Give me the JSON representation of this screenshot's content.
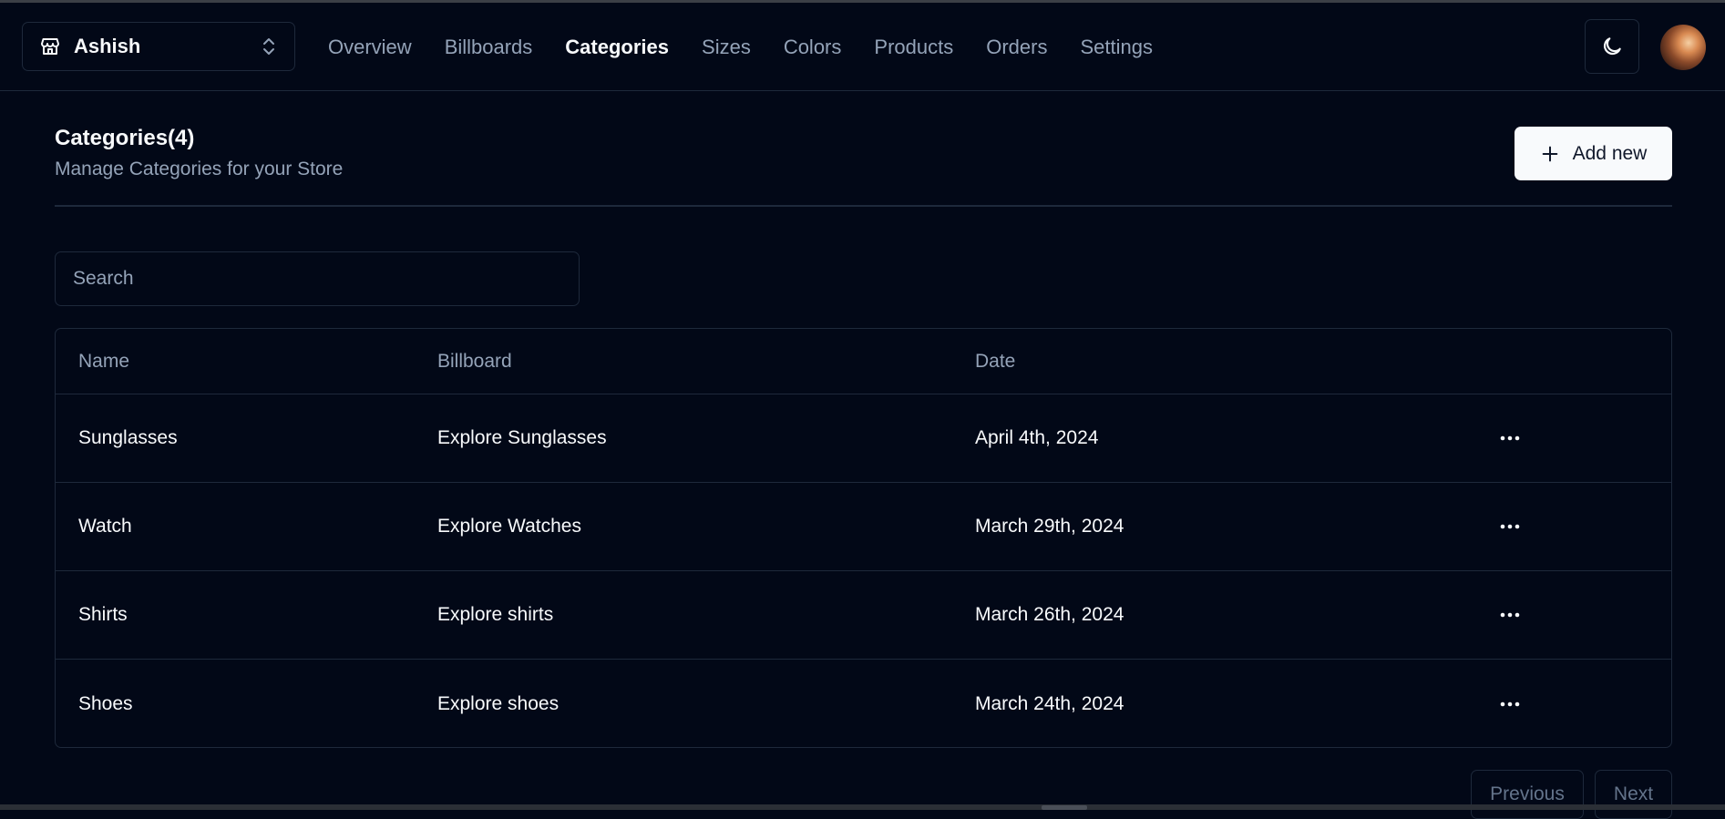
{
  "store": {
    "name": "Ashish"
  },
  "nav": {
    "items": [
      {
        "label": "Overview",
        "active": false
      },
      {
        "label": "Billboards",
        "active": false
      },
      {
        "label": "Categories",
        "active": true
      },
      {
        "label": "Sizes",
        "active": false
      },
      {
        "label": "Colors",
        "active": false
      },
      {
        "label": "Products",
        "active": false
      },
      {
        "label": "Orders",
        "active": false
      },
      {
        "label": "Settings",
        "active": false
      }
    ]
  },
  "header": {
    "title": "Categories(4)",
    "subtitle": "Manage Categories for your Store",
    "add_label": "Add new"
  },
  "search": {
    "placeholder": "Search",
    "value": ""
  },
  "table": {
    "columns": [
      "Name",
      "Billboard",
      "Date"
    ],
    "rows": [
      {
        "name": "Sunglasses",
        "billboard": "Explore Sunglasses",
        "date": "April 4th, 2024"
      },
      {
        "name": "Watch",
        "billboard": "Explore Watches",
        "date": "March 29th, 2024"
      },
      {
        "name": "Shirts",
        "billboard": "Explore shirts",
        "date": "March 26th, 2024"
      },
      {
        "name": "Shoes",
        "billboard": "Explore shoes",
        "date": "March 24th, 2024"
      }
    ]
  },
  "pagination": {
    "previous_label": "Previous",
    "next_label": "Next"
  },
  "icons": {
    "store": "store-icon",
    "switcher": "chevrons-up-down-icon",
    "theme": "moon-icon",
    "add": "plus-icon",
    "row_actions": "more-horizontal-icon"
  },
  "colors": {
    "background": "#020817",
    "border": "#1e293b",
    "muted_text": "#94a3b8",
    "foreground": "#f8fafc"
  }
}
